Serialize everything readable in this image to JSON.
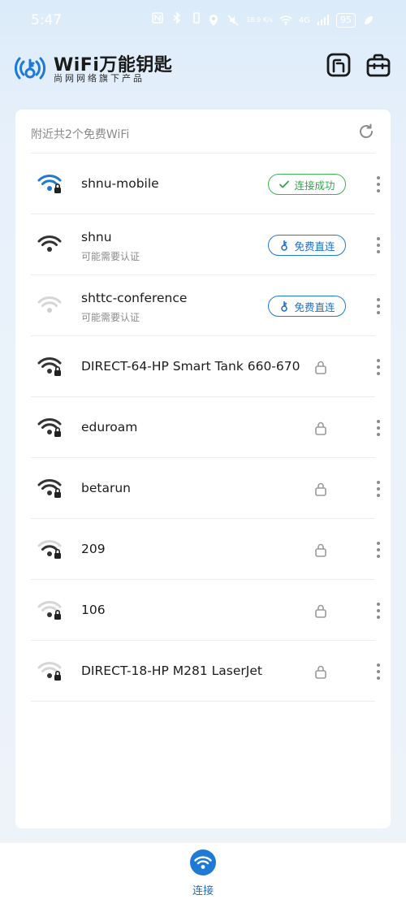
{
  "status_bar": {
    "time": "5:47",
    "network_speed": "18.9 K/s",
    "signal": "4G",
    "battery": "95"
  },
  "header": {
    "title": "WiFi万能钥匙",
    "subtitle": "尚网网络旗下产品"
  },
  "list": {
    "nearby_text": "附近共2个免费WiFi",
    "networks": [
      {
        "ssid": "shnu-mobile",
        "hint": "",
        "action": "连接成功",
        "action_type": "connected",
        "signal": 3,
        "locked": true,
        "color": "#1f7ad6"
      },
      {
        "ssid": "shnu",
        "hint": "可能需要认证",
        "action": "免费直连",
        "action_type": "free",
        "signal": 3,
        "locked": false,
        "color": "#333333"
      },
      {
        "ssid": "shttc-conference",
        "hint": "可能需要认证",
        "action": "免费直连",
        "action_type": "free",
        "signal": 1,
        "locked": false,
        "color": "#cfcfcf"
      },
      {
        "ssid": "DIRECT-64-HP Smart Tank 660-670",
        "hint": "",
        "action": "",
        "action_type": "lock",
        "signal": 3,
        "locked": true,
        "color": "#333333"
      },
      {
        "ssid": "eduroam",
        "hint": "",
        "action": "",
        "action_type": "lock",
        "signal": 3,
        "locked": true,
        "color": "#333333"
      },
      {
        "ssid": "betarun",
        "hint": "",
        "action": "",
        "action_type": "lock",
        "signal": 3,
        "locked": true,
        "color": "#333333"
      },
      {
        "ssid": "209",
        "hint": "",
        "action": "",
        "action_type": "lock",
        "signal": 2,
        "locked": true,
        "color": "#333333"
      },
      {
        "ssid": "106",
        "hint": "",
        "action": "",
        "action_type": "lock",
        "signal": 1,
        "locked": true,
        "color": "#333333"
      },
      {
        "ssid": "DIRECT-18-HP M281 LaserJet",
        "hint": "",
        "action": "",
        "action_type": "lock",
        "signal": 1,
        "locked": true,
        "color": "#333333"
      }
    ]
  },
  "bottom_nav": {
    "connect_label": "连接"
  },
  "colors": {
    "accent": "#1f7ad6",
    "success": "#3cb45a"
  },
  "icons": {
    "logo": "wifi-key-logo-icon",
    "clipboard": "clipboard-icon",
    "bag": "bag-icon",
    "refresh": "refresh-icon",
    "wifi": "wifi-icon",
    "lock": "lock-icon",
    "more": "more-vertical-icon",
    "key": "key-icon",
    "check": "check-icon"
  }
}
